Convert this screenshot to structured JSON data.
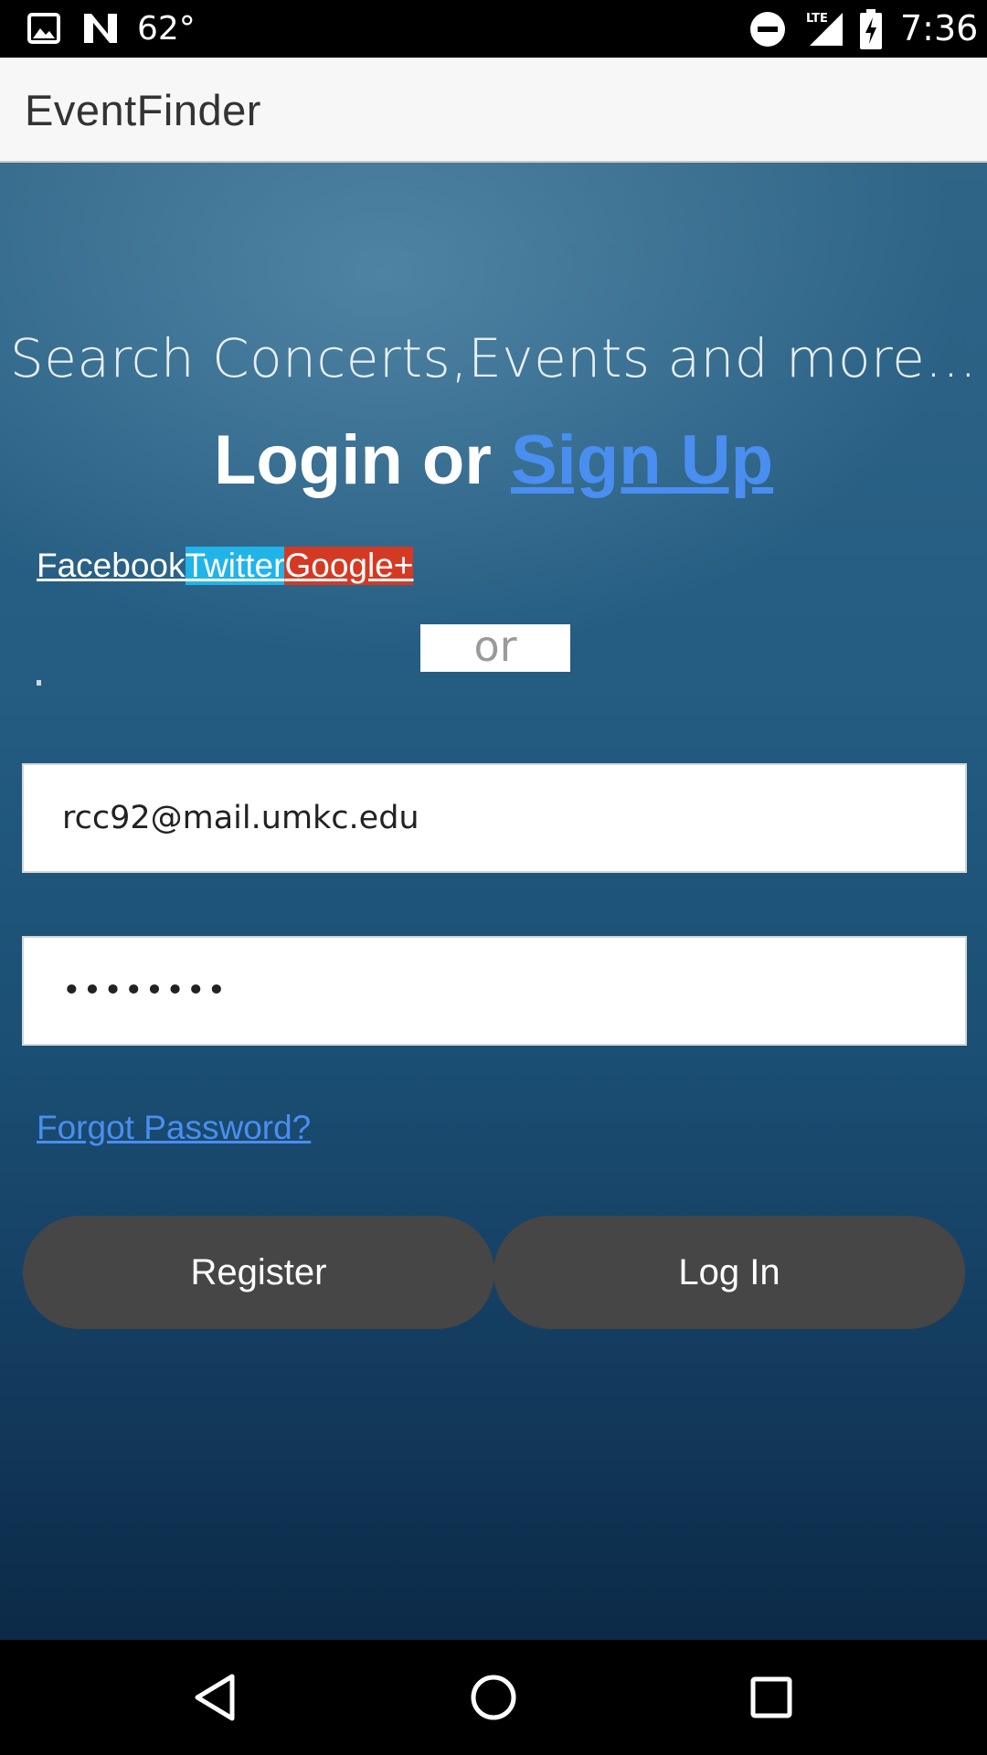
{
  "status_bar": {
    "temperature": "62°",
    "time": "7:36",
    "icons": [
      "gallery-icon",
      "n-notification-icon",
      "do-not-disturb-icon",
      "lte-signal-icon",
      "battery-charging-icon"
    ],
    "network_label": "LTE"
  },
  "app_bar": {
    "title": "EventFinder"
  },
  "main": {
    "tagline": "Search Concerts,Events and more...",
    "login_text": "Login or ",
    "signup_link": "Sign Up",
    "social": {
      "facebook": "Facebook",
      "twitter": "Twitter",
      "google": "Google+"
    },
    "divider_text": "or",
    "email": {
      "value": "rcc92@mail.umkc.edu",
      "placeholder": ""
    },
    "password": {
      "value": "••••••••",
      "placeholder": ""
    },
    "forgot_password": "Forgot Password?",
    "register_label": "Register",
    "login_label": "Log In"
  },
  "colors": {
    "accent_link": "#4a8ef0",
    "twitter": "#21b4e8",
    "google": "#d43a23",
    "button": "#464646"
  },
  "nav_bar": {
    "icons": [
      "back-icon",
      "home-icon",
      "recents-icon"
    ]
  }
}
